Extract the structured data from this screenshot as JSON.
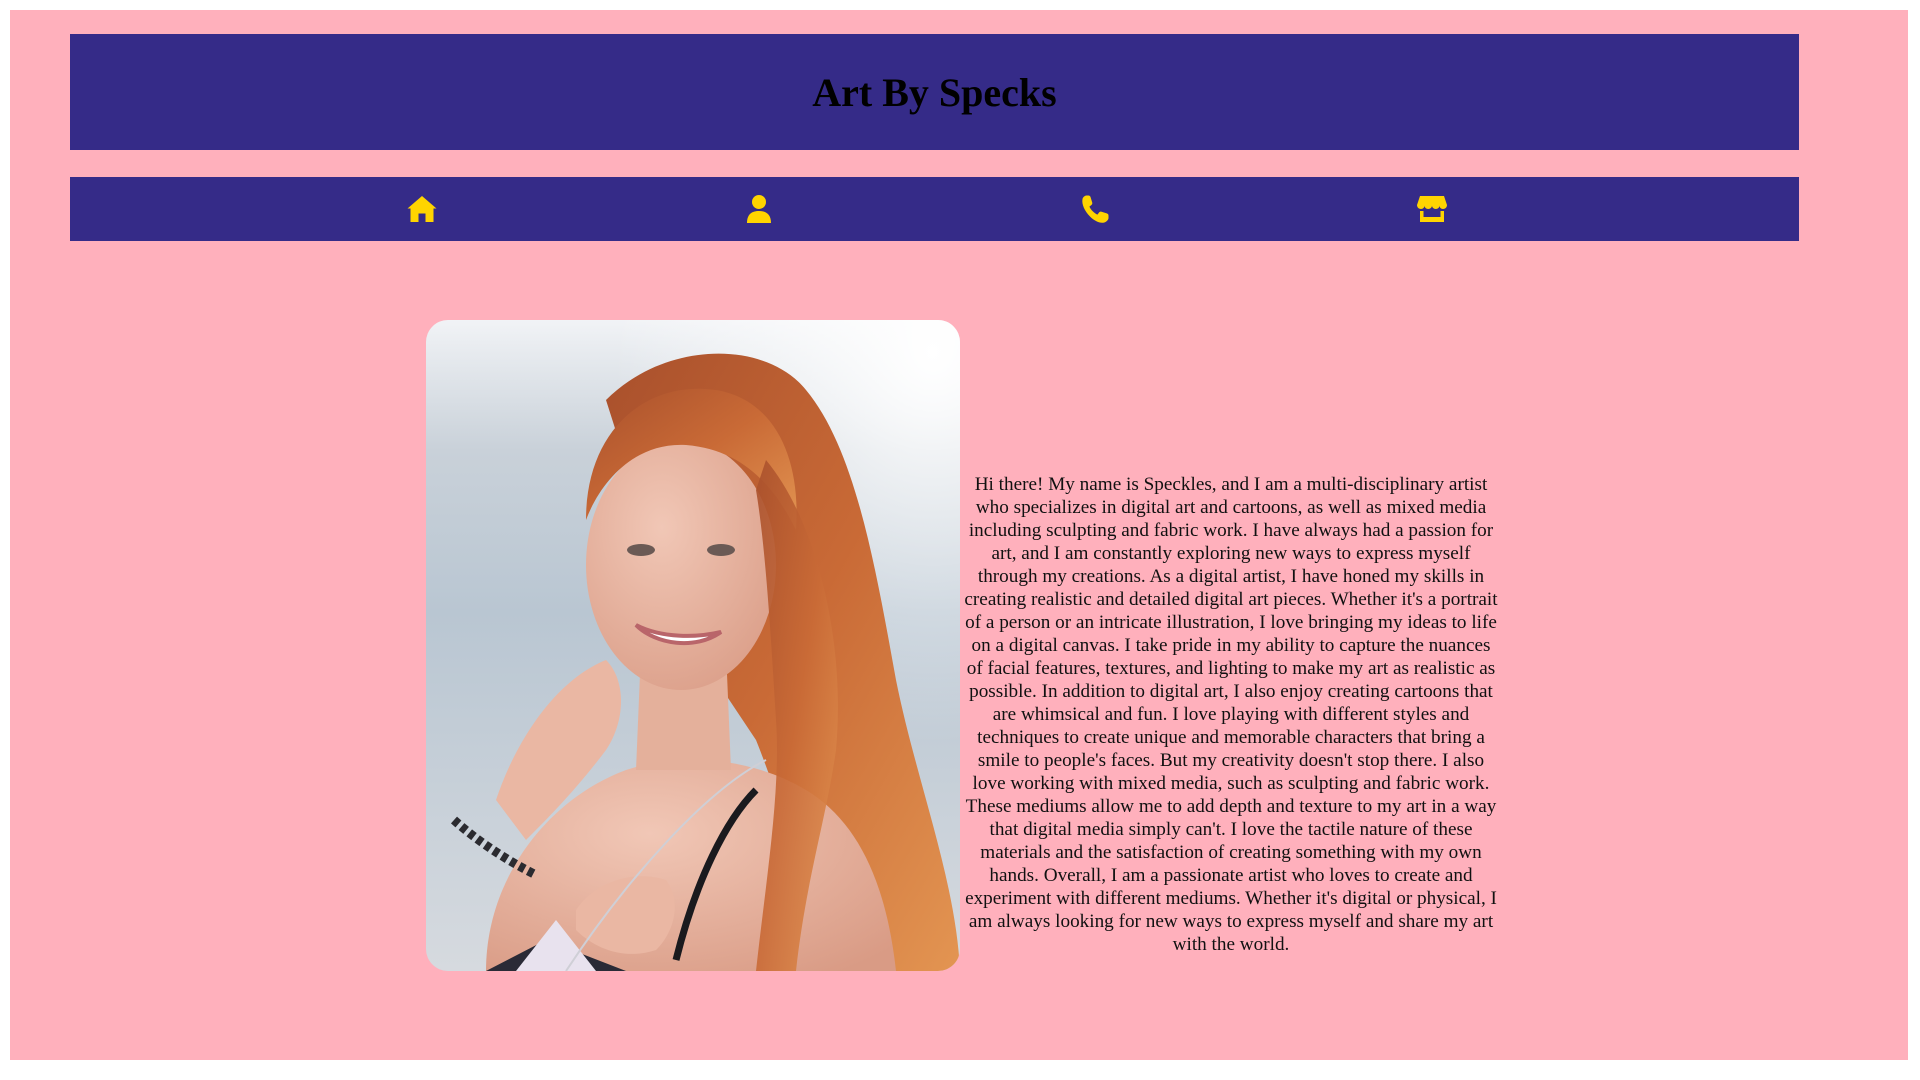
{
  "site": {
    "title": "Art By Specks"
  },
  "nav": {
    "items": [
      {
        "icon": "home-icon"
      },
      {
        "icon": "user-icon"
      },
      {
        "icon": "phone-icon"
      },
      {
        "icon": "shop-icon"
      }
    ]
  },
  "about": {
    "bio": "Hi there! My name is Speckles, and I am a multi-disciplinary artist who specializes in digital art and cartoons, as well as mixed media including sculpting and fabric work. I have always had a passion for art, and I am constantly exploring new ways to express myself through my creations. As a digital artist, I have honed my skills in creating realistic and detailed digital art pieces. Whether it's a portrait of a person or an intricate illustration, I love bringing my ideas to life on a digital canvas. I take pride in my ability to capture the nuances of facial features, textures, and lighting to make my art as realistic as possible. In addition to digital art, I also enjoy creating cartoons that are whimsical and fun. I love playing with different styles and techniques to create unique and memorable characters that bring a smile to people's faces. But my creativity doesn't stop there. I also love working with mixed media, such as sculpting and fabric work. These mediums allow me to add depth and texture to my art in a way that digital media simply can't. I love the tactile nature of these materials and the satisfaction of creating something with my own hands. Overall, I am a passionate artist who loves to create and experiment with different mediums. Whether it's digital or physical, I am always looking for new ways to express myself and share my art with the world."
  },
  "colors": {
    "background": "#ffb0bc",
    "bar": "#352b88",
    "icon": "#ffd400"
  }
}
